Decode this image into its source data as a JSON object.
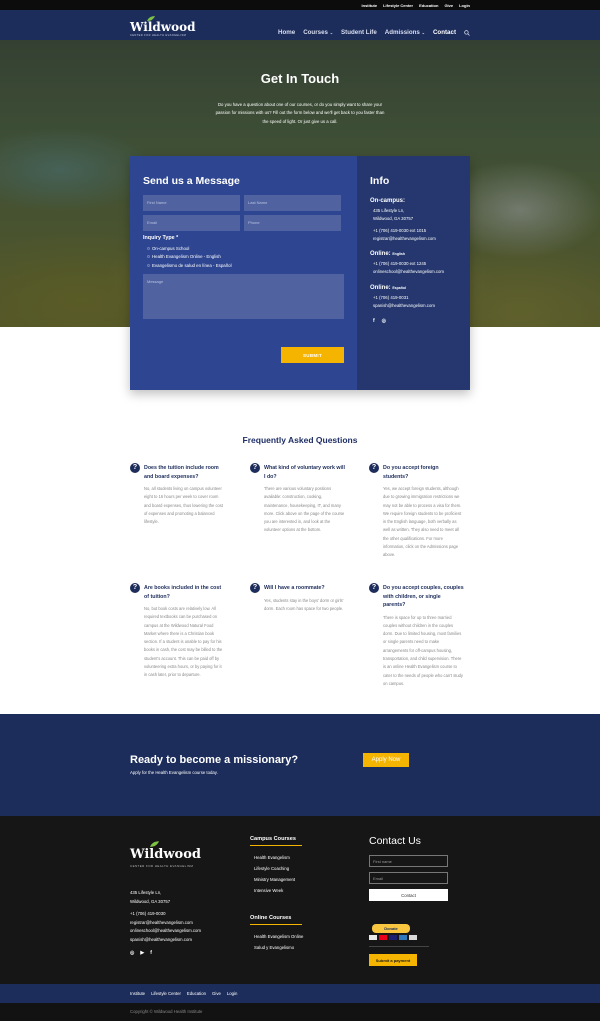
{
  "topbar": {
    "links": [
      "Institute",
      "Lifestyle Center",
      "Education",
      "Give",
      "Login"
    ]
  },
  "nav": {
    "logo_name": "Wildwood",
    "logo_tagline": "CENTER FOR HEALTH EVANGELISM",
    "menu": [
      "Home",
      "Courses",
      "Student Life",
      "Admissions",
      "Contact"
    ],
    "active": "Contact"
  },
  "hero": {
    "title": "Get In Touch",
    "text": "Do you have a question about one of our courses, or do you simply want to share your passion for missions with us? Fill out the form below and we'll get back to you faster than the speed of light. Or just give us a call."
  },
  "form": {
    "title": "Send us a Message",
    "first_name": "First Name",
    "last_name": "Last Name",
    "email": "Email",
    "phone": "Phone",
    "inquiry_label": "Inquiry Type *",
    "options": [
      "On-campus School",
      "Health Evangelism Online - English",
      "Evangelismo de salud en línea - Español"
    ],
    "message": "Message",
    "submit": "SUBMIT"
  },
  "info": {
    "title": "Info",
    "oncampus": {
      "heading": "On-campus:",
      "address1": "435 Lifestyle Ln,",
      "address2": "Wildwood, GA 30757",
      "phone": "+1 (706) 419-0030 ext 1015",
      "email": "registrar@healthevangelism.com"
    },
    "online_en": {
      "heading": "Online:",
      "sub": "English",
      "phone": "+1 (706) 419-0030 ext 1245",
      "email": "onlineschool@healthevangelism.com"
    },
    "online_es": {
      "heading": "Online:",
      "sub": "Español",
      "phone": "+1 (706) 419-0031",
      "email": "spanish@healthevangelism.com"
    },
    "social": [
      "f",
      "◎"
    ]
  },
  "faq": {
    "title": "Frequently Asked Questions",
    "items": [
      {
        "q": "Does the tuition include room and board expenses?",
        "a": "No, all students living on campus volunteer eight to 16 hours per week to cover room and board expenses, thus lowering the cost of expenses and promoting a balanced lifestyle."
      },
      {
        "q": "What kind of voluntary work will I do?",
        "a": "There are various voluntary positions available: construction, cooking, maintenance, housekeeping, IT, and many more. Click above on the page of the course you are interested in, and look at the volunteer options at the bottom."
      },
      {
        "q": "Do you accept foreign students?",
        "a": "Yes, we accept foreign students, although due to growing immigration restrictions we may not be able to process a visa for them. We require foreign students to be proficient in the English language, both verbally as well as written. They also need to meet all the other qualifications. For more information, click on the Admissions page above."
      },
      {
        "q": "Are books included in the cost of tuition?",
        "a": "No, but book costs are relatively low. All required textbooks can be purchased on campus at the Wildwood Natural Food Market where there is a Christian book section. If a student is unable to pay for his books in cash, the cost may be billed to the student's account. This can be paid off by volunteering extra hours, or by paying for it in cash later, prior to departure."
      },
      {
        "q": "Will I have a roommate?",
        "a": "Yes, students stay in the boys' dorm or girls' dorm. Each room has space for two people."
      },
      {
        "q": "Do you accept couples, couples with children, or single parents?",
        "a": "There is space for up to three married couples without children in the couples dorm. Due to limited housing, most families or single parents need to make arrangements for off-campus housing, transportation, and child supervision. There is an online Health Evangelism course to cater to the needs of people who can't study on campus."
      }
    ]
  },
  "cta": {
    "title": "Ready to become a missionary?",
    "subtitle": "Apply for the Health Evangelism course today.",
    "button": "Apply Now"
  },
  "footer": {
    "logo_name": "Wildwood",
    "logo_tagline": "CENTER FOR HEALTH EVANGELISM",
    "address1": "435 Lifestyle Ln,",
    "address2": "Wildwood, GA 30757",
    "contacts": [
      "+1 (706) 419-0030",
      "registrar@healthevangelism.com",
      "onlineschool@healthevangelism.com",
      "spanish@healthevangelism.com"
    ],
    "social": [
      "◎",
      "▶",
      "f"
    ],
    "campus_heading": "Campus Courses",
    "campus_courses": [
      "Health Evangelism",
      "Lifestyle Coaching",
      "Ministry Management",
      "Intensive Week"
    ],
    "online_heading": "Online Courses",
    "online_courses": [
      "Health Evangelism Online",
      "Salud y Evangelismo"
    ],
    "contact_title": "Contact Us",
    "first_name": "First name",
    "email": "Email",
    "contact_button": "Contact",
    "donate": "Donate",
    "payment_button": "Submit a payment"
  },
  "bottomnav": {
    "links": [
      "Institute",
      "Lifestyle Center",
      "Education",
      "Give",
      "Login"
    ]
  },
  "copyright": "Copyright © Wildwood Health Institute",
  "colors": {
    "navy": "#1d2d5b",
    "form_blue": "#2e4691",
    "info_blue": "#25376e",
    "accent": "#f4b400"
  }
}
